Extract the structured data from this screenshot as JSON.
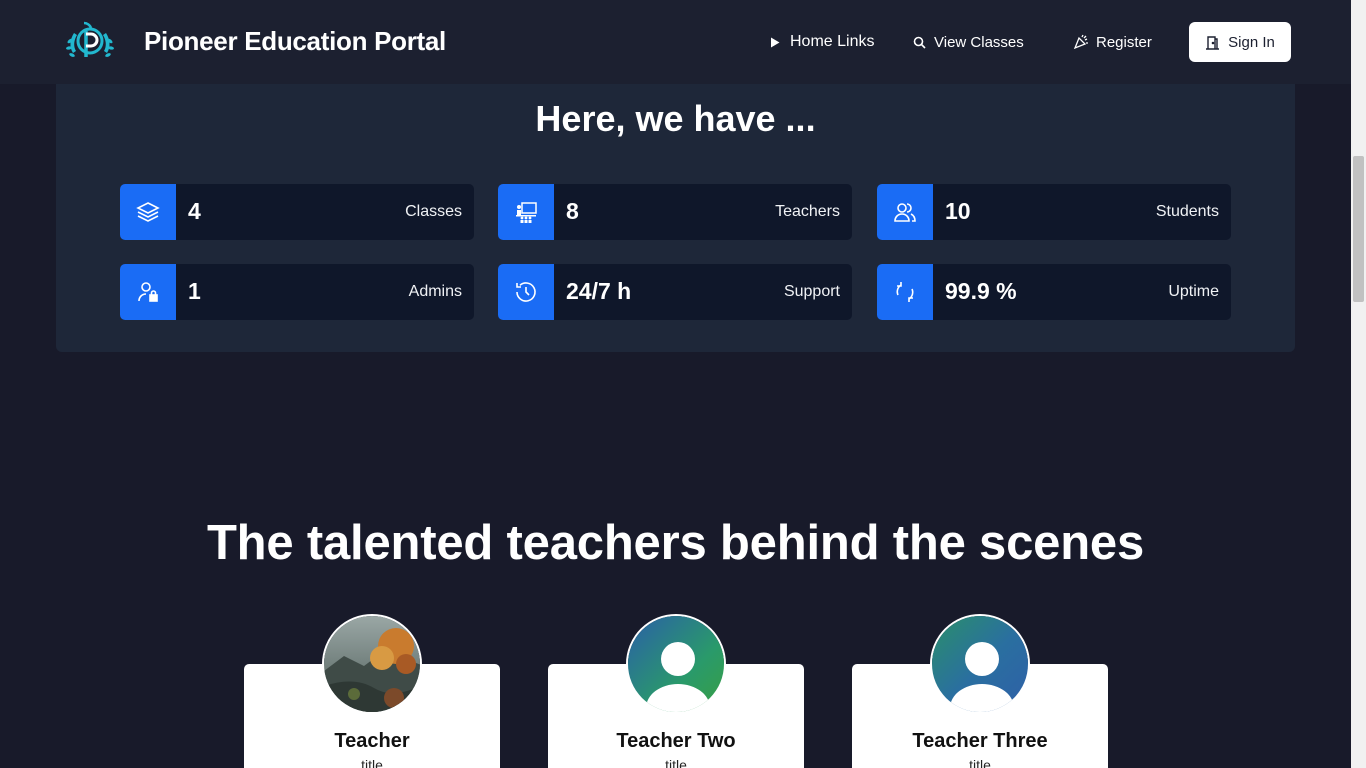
{
  "header": {
    "brand": "Pioneer Education Portal",
    "nav": {
      "home_links": "Home Links",
      "view_classes": "View Classes",
      "register": "Register",
      "sign_in": "Sign In"
    }
  },
  "stats": {
    "title": "Here, we have ...",
    "items": [
      {
        "value": "4",
        "label": "Classes",
        "icon": "layers-icon"
      },
      {
        "value": "8",
        "label": "Teachers",
        "icon": "teacher-icon"
      },
      {
        "value": "10",
        "label": "Students",
        "icon": "users-icon"
      },
      {
        "value": "1",
        "label": "Admins",
        "icon": "admin-lock-icon"
      },
      {
        "value": "24/7 h",
        "label": "Support",
        "icon": "history-icon"
      },
      {
        "value": "99.9 %",
        "label": "Uptime",
        "icon": "refresh-icon"
      }
    ]
  },
  "teachers": {
    "title": "The talented teachers behind the scenes",
    "items": [
      {
        "name": "Teacher",
        "title": "title",
        "avatar": "landscape-photo"
      },
      {
        "name": "Teacher Two",
        "title": "title",
        "avatar": "default-user-avatar"
      },
      {
        "name": "Teacher Three",
        "title": "title",
        "avatar": "default-user-avatar"
      }
    ]
  },
  "colors": {
    "background": "#181a2a",
    "header": "#1c2030",
    "panel": "#1e2739",
    "card": "#0f172a",
    "accent": "#1a6cf5"
  }
}
